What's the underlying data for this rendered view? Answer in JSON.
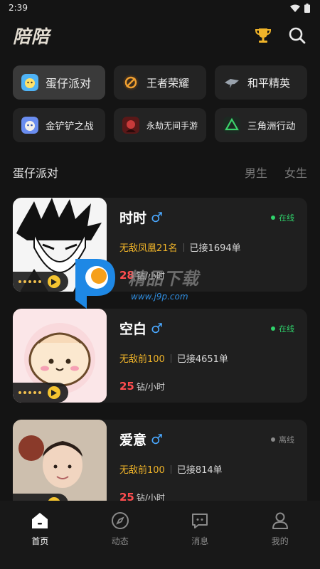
{
  "status_bar": {
    "time": "2:39"
  },
  "header": {
    "logo_text": "陪陪"
  },
  "games": [
    {
      "label": "蛋仔派对",
      "active": true
    },
    {
      "label": "王者荣耀",
      "active": false
    },
    {
      "label": "和平精英",
      "active": false
    },
    {
      "label": "金铲铲之战",
      "active": false
    },
    {
      "label": "永劫无间手游",
      "active": false
    },
    {
      "label": "三角洲行动",
      "active": false
    }
  ],
  "section": {
    "title": "蛋仔派对",
    "filters": [
      "男生",
      "女生"
    ]
  },
  "players": [
    {
      "name": "时时",
      "gender_symbol": "♂",
      "status": "在线",
      "rank": "无敌凤凰21名",
      "orders": "已接1694单",
      "price": "28",
      "price_unit": "钻/小时"
    },
    {
      "name": "空白",
      "gender_symbol": "♂",
      "status": "在线",
      "rank": "无敌前100",
      "orders": "已接4651单",
      "price": "25",
      "price_unit": "钻/小时"
    },
    {
      "name": "爱意",
      "gender_symbol": "♂",
      "status": "离线",
      "rank": "无敌前100",
      "orders": "已接814单",
      "price": "25",
      "price_unit": "钻/小时"
    }
  ],
  "watermark": {
    "text": "精品下载",
    "url": "www.j9p.com"
  },
  "bottom_nav": [
    {
      "label": "首页",
      "icon": "home-icon",
      "active": true
    },
    {
      "label": "动态",
      "icon": "compass-icon",
      "active": false
    },
    {
      "label": "消息",
      "icon": "message-icon",
      "active": false
    },
    {
      "label": "我的",
      "icon": "profile-icon",
      "active": false
    }
  ],
  "colors": {
    "online": "#2fd36b",
    "offline": "#8a8a8a",
    "accent_gold": "#f0b429",
    "price_red": "#ff4d4f",
    "gender_blue": "#4aa8ff"
  }
}
